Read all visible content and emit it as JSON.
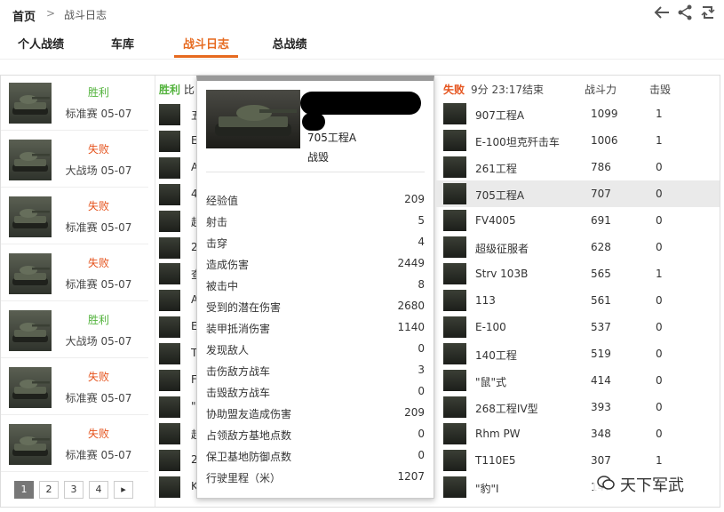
{
  "breadcrumb": {
    "home": "首页",
    "sep": ">",
    "current": "战斗日志"
  },
  "tabs": [
    "个人战绩",
    "车库",
    "战斗日志",
    "总战绩"
  ],
  "active_tab": 2,
  "battles": [
    {
      "result": "胜利",
      "type": "win",
      "meta": "标准赛 05-07"
    },
    {
      "result": "失败",
      "type": "lose",
      "meta": "大战场 05-07"
    },
    {
      "result": "失败",
      "type": "lose",
      "meta": "标准赛 05-07"
    },
    {
      "result": "失败",
      "type": "lose",
      "meta": "标准赛 05-07"
    },
    {
      "result": "胜利",
      "type": "win",
      "meta": "大战场 05-07"
    },
    {
      "result": "失败",
      "type": "lose",
      "meta": "标准赛 05-07"
    },
    {
      "result": "失败",
      "type": "lose",
      "meta": "标准赛 05-07"
    }
  ],
  "pager": [
    "1",
    "2",
    "3",
    "4",
    "▸"
  ],
  "mid": {
    "result": "胜利",
    "extra": "比",
    "rows": [
      "五",
      "E",
      "A",
      "4",
      "超",
      "2",
      "查",
      "A",
      "E",
      "T",
      "F",
      "\"",
      "超",
      "2",
      "K"
    ]
  },
  "popup": {
    "tank": "705工程A",
    "state": "战毁",
    "stats": [
      {
        "label": "经验值",
        "value": "209"
      },
      {
        "label": "射击",
        "value": "5"
      },
      {
        "label": "击穿",
        "value": "4"
      },
      {
        "label": "造成伤害",
        "value": "2449"
      },
      {
        "label": "被击中",
        "value": "8"
      },
      {
        "label": "受到的潜在伤害",
        "value": "2680"
      },
      {
        "label": "装甲抵消伤害",
        "value": "1140"
      },
      {
        "label": "发现敌人",
        "value": "0"
      },
      {
        "label": "击伤敌方战车",
        "value": "3"
      },
      {
        "label": "击毁敌方战车",
        "value": "0"
      },
      {
        "label": "协助盟友造成伤害",
        "value": "209"
      },
      {
        "label": "占领敌方基地点数",
        "value": "0"
      },
      {
        "label": "保卫基地防御点数",
        "value": "0"
      },
      {
        "label": "行驶里程（米）",
        "value": "1207"
      }
    ]
  },
  "team": {
    "result": "失败",
    "time": "9分 23:17结束",
    "col_power": "战斗力",
    "col_kills": "击毁",
    "rows": [
      {
        "name": "907工程A",
        "power": "1099",
        "kills": "1"
      },
      {
        "name": "E-100坦克歼击车",
        "power": "1006",
        "kills": "1"
      },
      {
        "name": "261工程",
        "power": "786",
        "kills": "0"
      },
      {
        "name": "705工程A",
        "power": "707",
        "kills": "0"
      },
      {
        "name": "FV4005",
        "power": "691",
        "kills": "0"
      },
      {
        "name": "超级征服者",
        "power": "628",
        "kills": "0"
      },
      {
        "name": "Strv 103B",
        "power": "565",
        "kills": "1"
      },
      {
        "name": "113",
        "power": "561",
        "kills": "0"
      },
      {
        "name": "E-100",
        "power": "537",
        "kills": "0"
      },
      {
        "name": "140工程",
        "power": "519",
        "kills": "0"
      },
      {
        "name": "\"鼠\"式",
        "power": "414",
        "kills": "0"
      },
      {
        "name": "268工程IV型",
        "power": "393",
        "kills": "0"
      },
      {
        "name": "Rhm PW",
        "power": "348",
        "kills": "0"
      },
      {
        "name": "T110E5",
        "power": "307",
        "kills": "1"
      },
      {
        "name": "\"豹\"I",
        "power": "147",
        "kills": "0"
      }
    ],
    "highlight": 3
  },
  "watermark": "天下军武"
}
